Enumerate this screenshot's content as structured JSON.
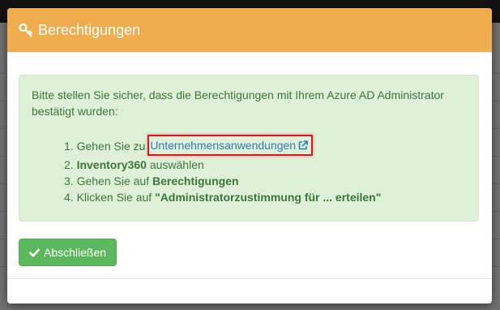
{
  "modal": {
    "title": "Berechtigungen",
    "icon": "key-icon",
    "header_color": "#f0ad4e"
  },
  "alert": {
    "intro": "Bitte stellen Sie sicher, dass die Berechtigungen mit Ihrem Azure AD Administrator bestätigt wurden:",
    "step1_prefix": "1. Gehen Sie zu ",
    "step1_link": "Unternehmensanwendungen",
    "step1_link_icon": "external-link-icon",
    "step2_bold": "Inventory360",
    "step2_suffix": " auswählen",
    "step2_num": "2. ",
    "step3_prefix": "3. Gehen Sie auf ",
    "step3_bold": "Berechtigungen",
    "step4_prefix": "4. Klicken Sie auf ",
    "step4_bold": "\"Administratorzustimmung für ... erteilen\""
  },
  "footer": {
    "finish_label": "Abschließen",
    "finish_icon": "check-icon",
    "finish_color": "#5cb85c"
  },
  "colors": {
    "alert_bg": "#dff0d8",
    "alert_text": "#3c763d",
    "link": "#337ab7",
    "highlight_border": "#e0141e"
  }
}
